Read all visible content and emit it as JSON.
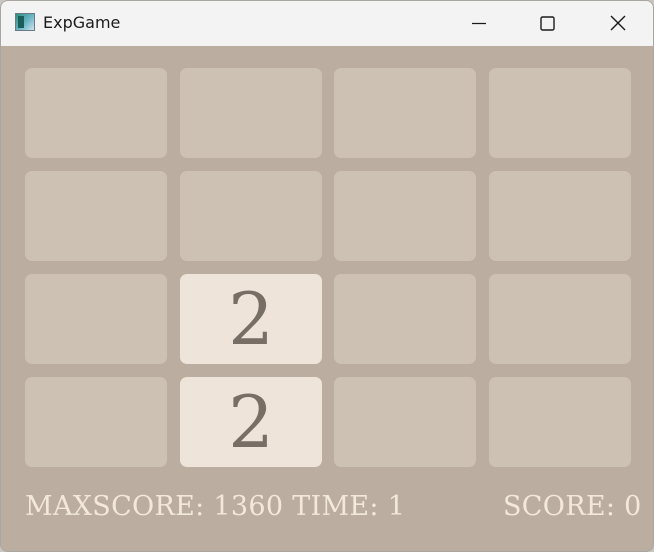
{
  "window": {
    "title": "ExpGame",
    "icon": "app-window-icon",
    "controls": [
      "minimize-icon",
      "maximize-icon",
      "close-icon"
    ]
  },
  "colors": {
    "board_background": "#bbada0",
    "empty_tile": "#cdc1b4",
    "tile_2": "#eee4da",
    "tile_text": "#776e65",
    "status_text": "#f3e8dc"
  },
  "board": {
    "rows": [
      [
        "",
        "",
        "",
        ""
      ],
      [
        "",
        "",
        "",
        ""
      ],
      [
        "",
        "2",
        "",
        ""
      ],
      [
        "",
        "2",
        "",
        ""
      ]
    ]
  },
  "status": {
    "maxscore_label": "MAXSCORE:",
    "maxscore_value": "1360",
    "time_label": "TIME:",
    "time_value": "1",
    "score_label": "SCORE:",
    "score_value": "0"
  }
}
